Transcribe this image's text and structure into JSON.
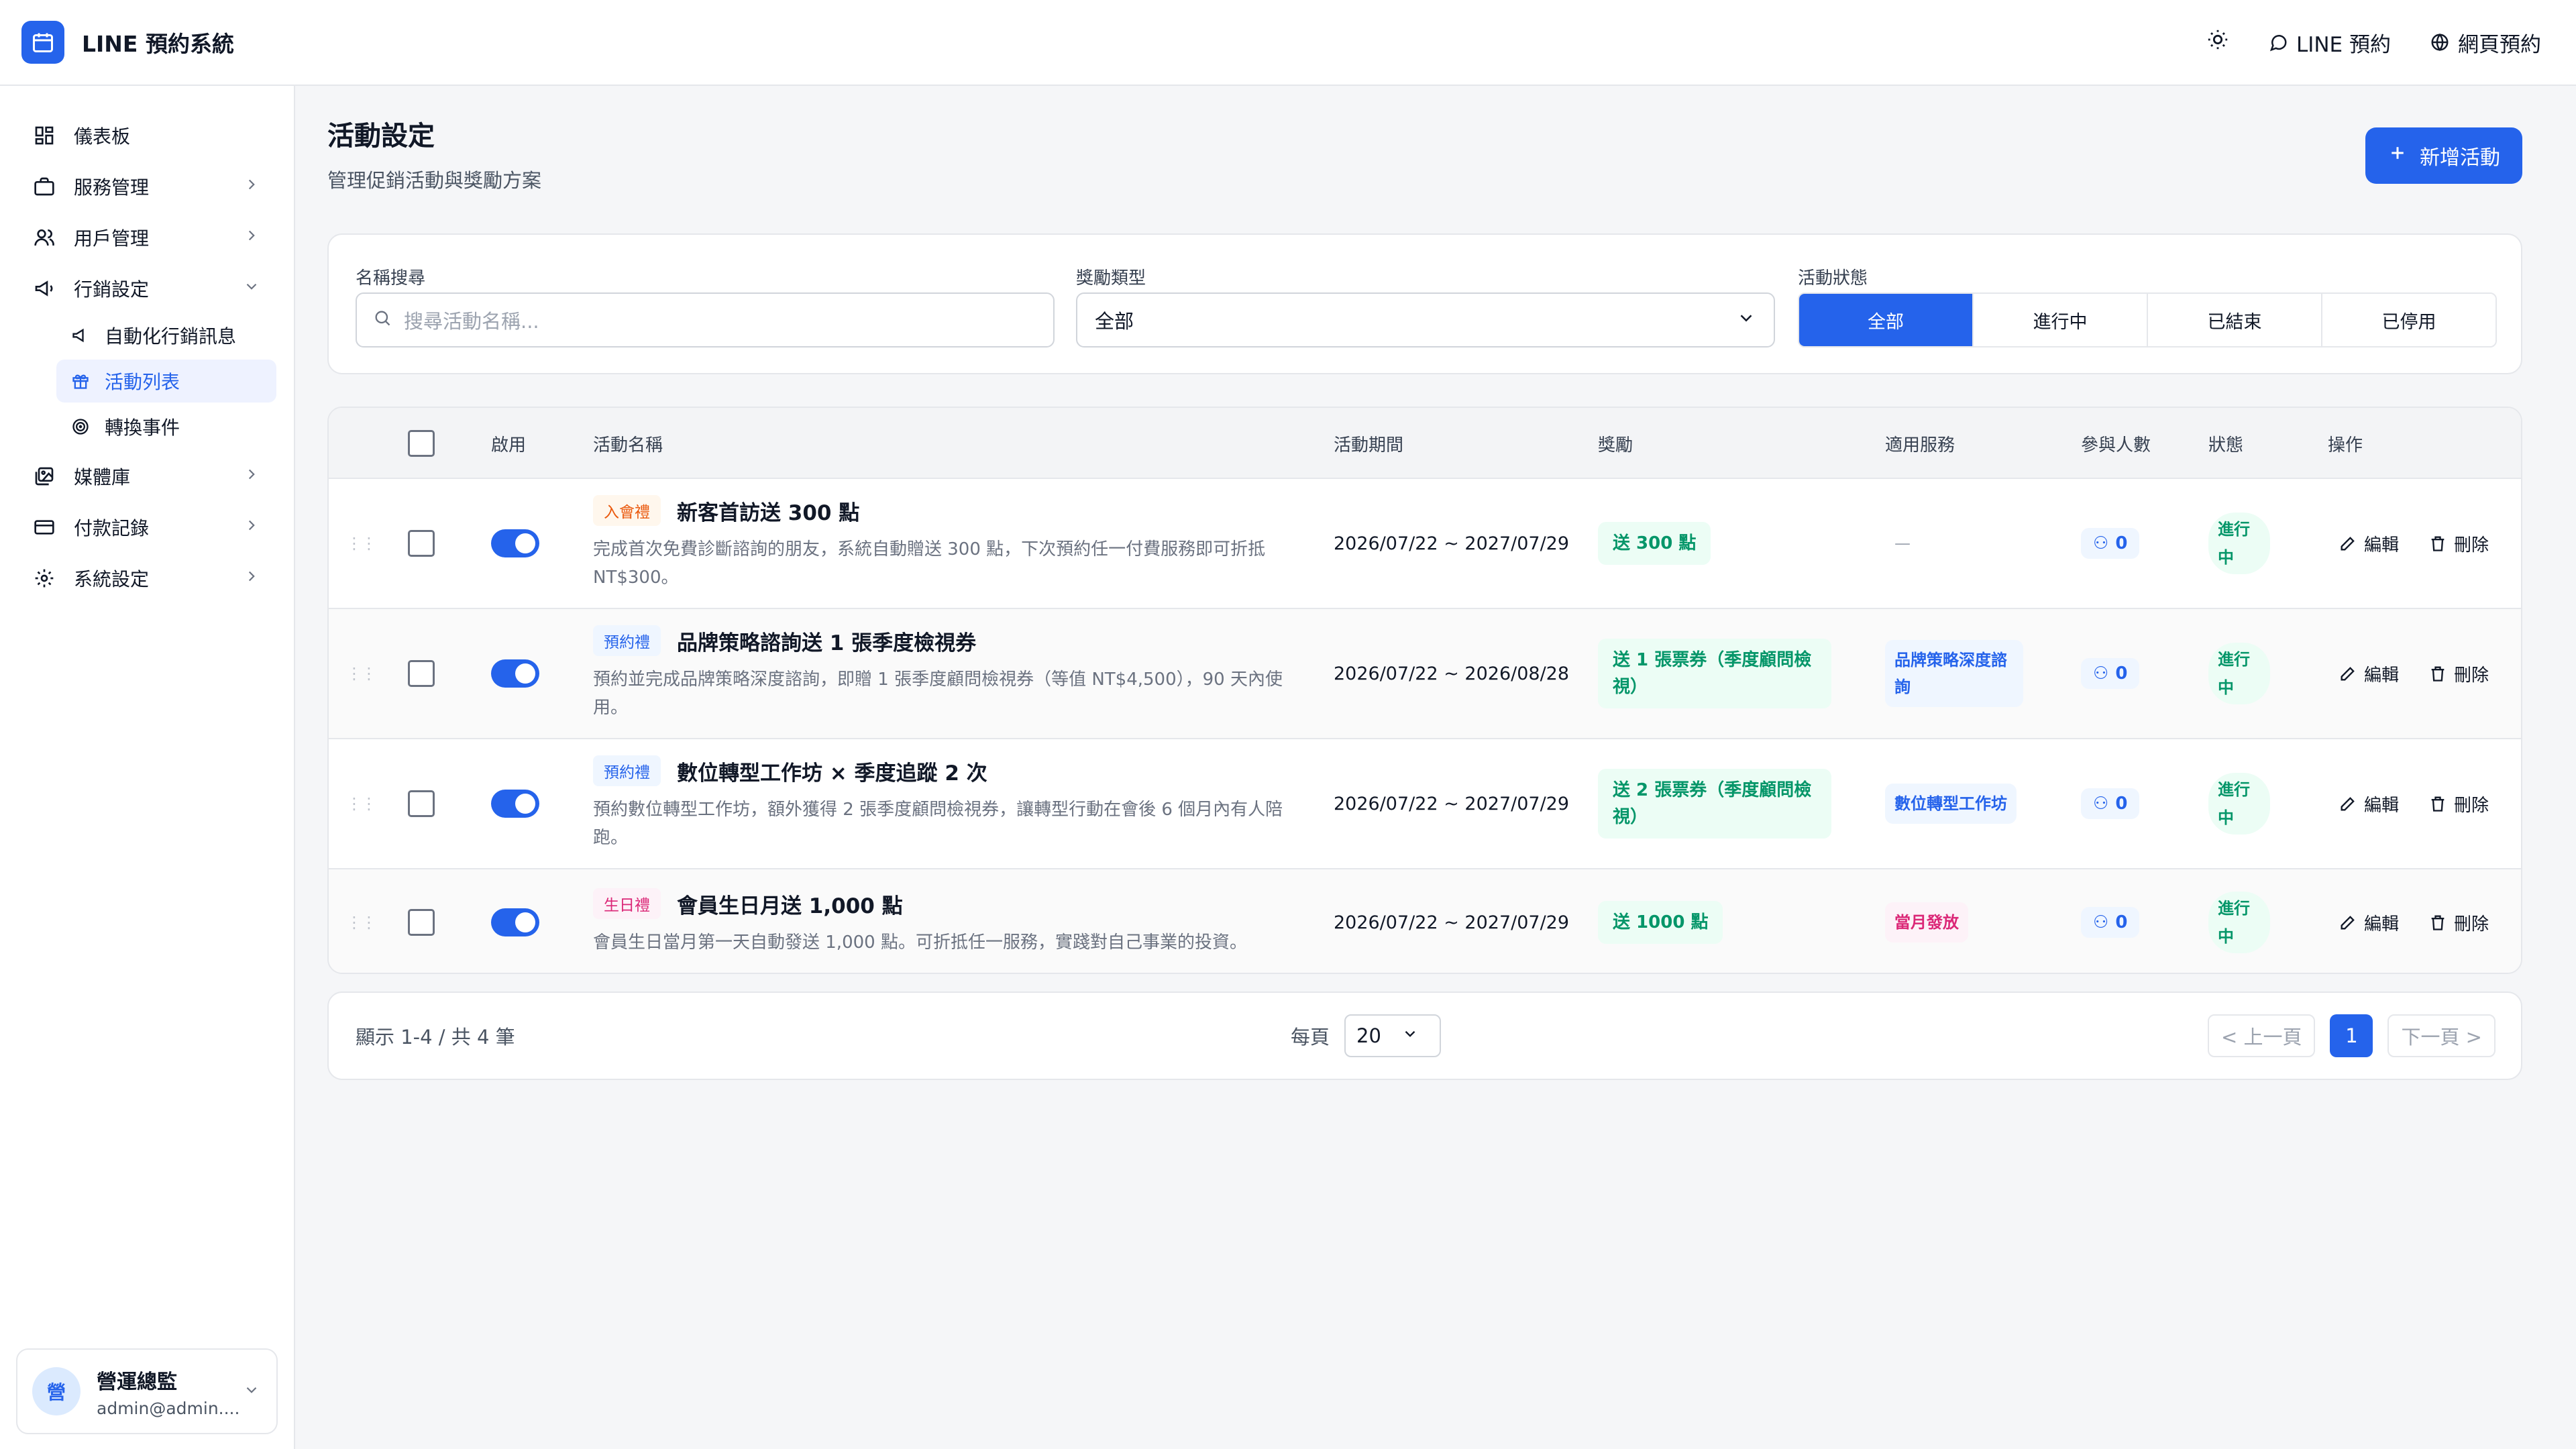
{
  "app": {
    "title": "LINE 預約系統"
  },
  "topbar": {
    "line_booking": "LINE 預約",
    "web_booking": "網頁預約"
  },
  "sidebar": {
    "items": [
      {
        "label": "儀表板",
        "icon": "dashboard-icon"
      },
      {
        "label": "服務管理",
        "icon": "briefcase-icon"
      },
      {
        "label": "用戶管理",
        "icon": "users-icon"
      },
      {
        "label": "行銷設定",
        "icon": "megaphone-icon"
      },
      {
        "label": "媒體庫",
        "icon": "gallery-icon"
      },
      {
        "label": "付款記錄",
        "icon": "credit-card-icon"
      },
      {
        "label": "系統設定",
        "icon": "settings-icon"
      }
    ],
    "subitems": [
      {
        "label": "自動化行銷訊息",
        "icon": "megaphone-icon"
      },
      {
        "label": "活動列表",
        "icon": "gift-icon",
        "active": true
      },
      {
        "label": "轉換事件",
        "icon": "target-icon"
      }
    ],
    "user": {
      "avatar": "營",
      "name": "營運總監",
      "email": "admin@admin...."
    }
  },
  "page": {
    "title": "活動設定",
    "subtitle": "管理促銷活動與獎勵方案",
    "add_button": "新增活動"
  },
  "filters": {
    "name_label": "名稱搜尋",
    "name_placeholder": "搜尋活動名稱...",
    "type_label": "獎勵類型",
    "type_value": "全部",
    "status_label": "活動狀態",
    "status_options": [
      "全部",
      "進行中",
      "已結束",
      "已停用"
    ]
  },
  "table": {
    "headers": {
      "enabled": "啟用",
      "name": "活動名稱",
      "period": "活動期間",
      "reward": "獎勵",
      "service": "適用服務",
      "participants": "參與人數",
      "status": "狀態",
      "actions": "操作"
    },
    "rows": [
      {
        "tag": "入會禮",
        "name": "新客首訪送 300 點",
        "desc": "完成首次免費診斷諮詢的朋友，系統自動贈送 300 點，下次預約任一付費服務即可折抵 NT$300。",
        "period": "2026/07/22 ~ 2027/07/29",
        "reward": "送 300 點",
        "service": "—",
        "participants": "0",
        "status": "進行中",
        "edit": "編輯",
        "delete": "刪除"
      },
      {
        "tag": "預約禮",
        "name": "品牌策略諮詢送 1 張季度檢視券",
        "desc": "預約並完成品牌策略深度諮詢，即贈 1 張季度顧問檢視券（等值 NT$4,500），90 天內使用。",
        "period": "2026/07/22 ~ 2026/08/28",
        "reward": "送 1 張票券（季度顧問檢視）",
        "service": "品牌策略深度諮詢",
        "participants": "0",
        "status": "進行中",
        "edit": "編輯",
        "delete": "刪除"
      },
      {
        "tag": "預約禮",
        "name": "數位轉型工作坊 × 季度追蹤 2 次",
        "desc": "預約數位轉型工作坊，額外獲得 2 張季度顧問檢視券，讓轉型行動在會後 6 個月內有人陪跑。",
        "period": "2026/07/22 ~ 2027/07/29",
        "reward": "送 2 張票券（季度顧問檢視）",
        "service": "數位轉型工作坊",
        "participants": "0",
        "status": "進行中",
        "edit": "編輯",
        "delete": "刪除"
      },
      {
        "tag": "生日禮",
        "name": "會員生日月送 1,000 點",
        "desc": "會員生日當月第一天自動發送 1,000 點。可折抵任一服務，實踐對自己事業的投資。",
        "period": "2026/07/22 ~ 2027/07/29",
        "reward": "送 1000 點",
        "service": "當月發放",
        "participants": "0",
        "status": "進行中",
        "edit": "編輯",
        "delete": "刪除"
      }
    ]
  },
  "pagination": {
    "info": "顯示 1-4 / 共 4 筆",
    "per_page_label": "每頁",
    "per_page": "20",
    "prev": "< 上一頁",
    "page": "1",
    "next": "下一頁 >"
  },
  "colors": {
    "primary": "#2563eb",
    "success": "#059669",
    "success_bg": "#ecfdf5",
    "pink": "#db2777",
    "orange": "#ea580c"
  }
}
